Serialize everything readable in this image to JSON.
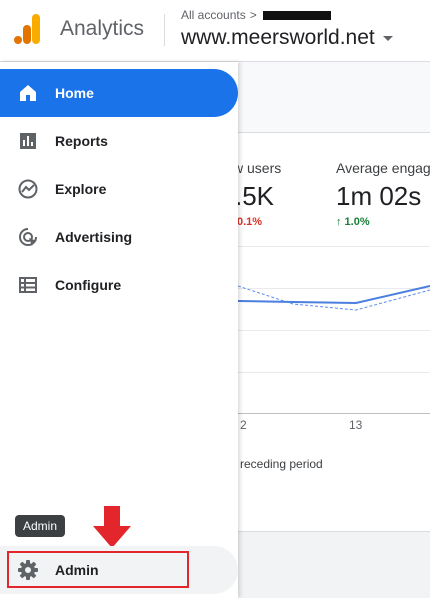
{
  "header": {
    "app_name": "Analytics",
    "accounts_label": "All accounts",
    "accounts_separator": ">",
    "property_name": "www.meersworld.net"
  },
  "sidebar": {
    "items": [
      {
        "label": "Home",
        "icon": "home-icon",
        "active": true
      },
      {
        "label": "Reports",
        "icon": "reports-icon"
      },
      {
        "label": "Explore",
        "icon": "explore-icon"
      },
      {
        "label": "Advertising",
        "icon": "advertising-icon"
      },
      {
        "label": "Configure",
        "icon": "configure-icon"
      }
    ],
    "admin": {
      "label": "Admin",
      "icon": "gear-icon",
      "tooltip": "Admin"
    }
  },
  "metrics": [
    {
      "label": "w users",
      "value": ".5K",
      "delta": "0.1%",
      "delta_direction": "down"
    },
    {
      "label": "Average engag",
      "value": "1m 02s",
      "delta": "↑ 1.0%",
      "delta_direction": "up"
    }
  ],
  "chart": {
    "x_ticks": [
      "2",
      "13"
    ],
    "legend_text": "receding period"
  },
  "colors": {
    "accent": "#1a73e8",
    "delta_down": "#d93025",
    "delta_up": "#188038",
    "annotation": "#e3262b"
  }
}
